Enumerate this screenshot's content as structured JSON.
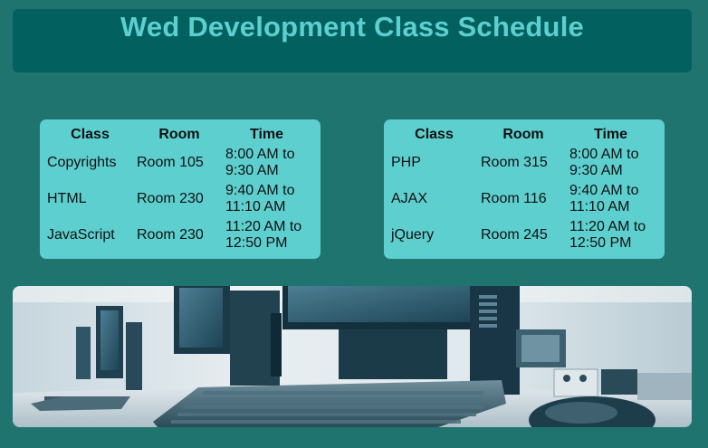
{
  "page": {
    "title": "Wed Development Class Schedule"
  },
  "schedules": [
    {
      "headers": [
        "Class",
        "Room",
        "Time"
      ],
      "rows": [
        {
          "class": "Copyrights",
          "room": "Room 105",
          "time_line1": "8:00 AM to",
          "time_line2": "9:30 AM"
        },
        {
          "class": "HTML",
          "room": "Room 230",
          "time_line1": "9:40 AM to",
          "time_line2": "11:10 AM"
        },
        {
          "class": "JavaScript",
          "room": "Room 230",
          "time_line1": "11:20 AM to",
          "time_line2": "12:50 PM"
        }
      ]
    },
    {
      "headers": [
        "Class",
        "Room",
        "Time"
      ],
      "rows": [
        {
          "class": "PHP",
          "room": "Room 315",
          "time_line1": "8:00 AM to",
          "time_line2": "9:30 AM"
        },
        {
          "class": "AJAX",
          "room": "Room 116",
          "time_line1": "9:40 AM to",
          "time_line2": "11:10 AM"
        },
        {
          "class": "jQuery",
          "room": "Room 245",
          "time_line1": "11:20 AM to",
          "time_line2": "12:50 PM"
        }
      ]
    }
  ],
  "colors": {
    "background": "#1f7470",
    "header_bg": "#02605e",
    "title_text": "#5ccfcf",
    "table_bg": "#5ecfcf"
  },
  "image": {
    "subject": "computer-lab-photo"
  }
}
